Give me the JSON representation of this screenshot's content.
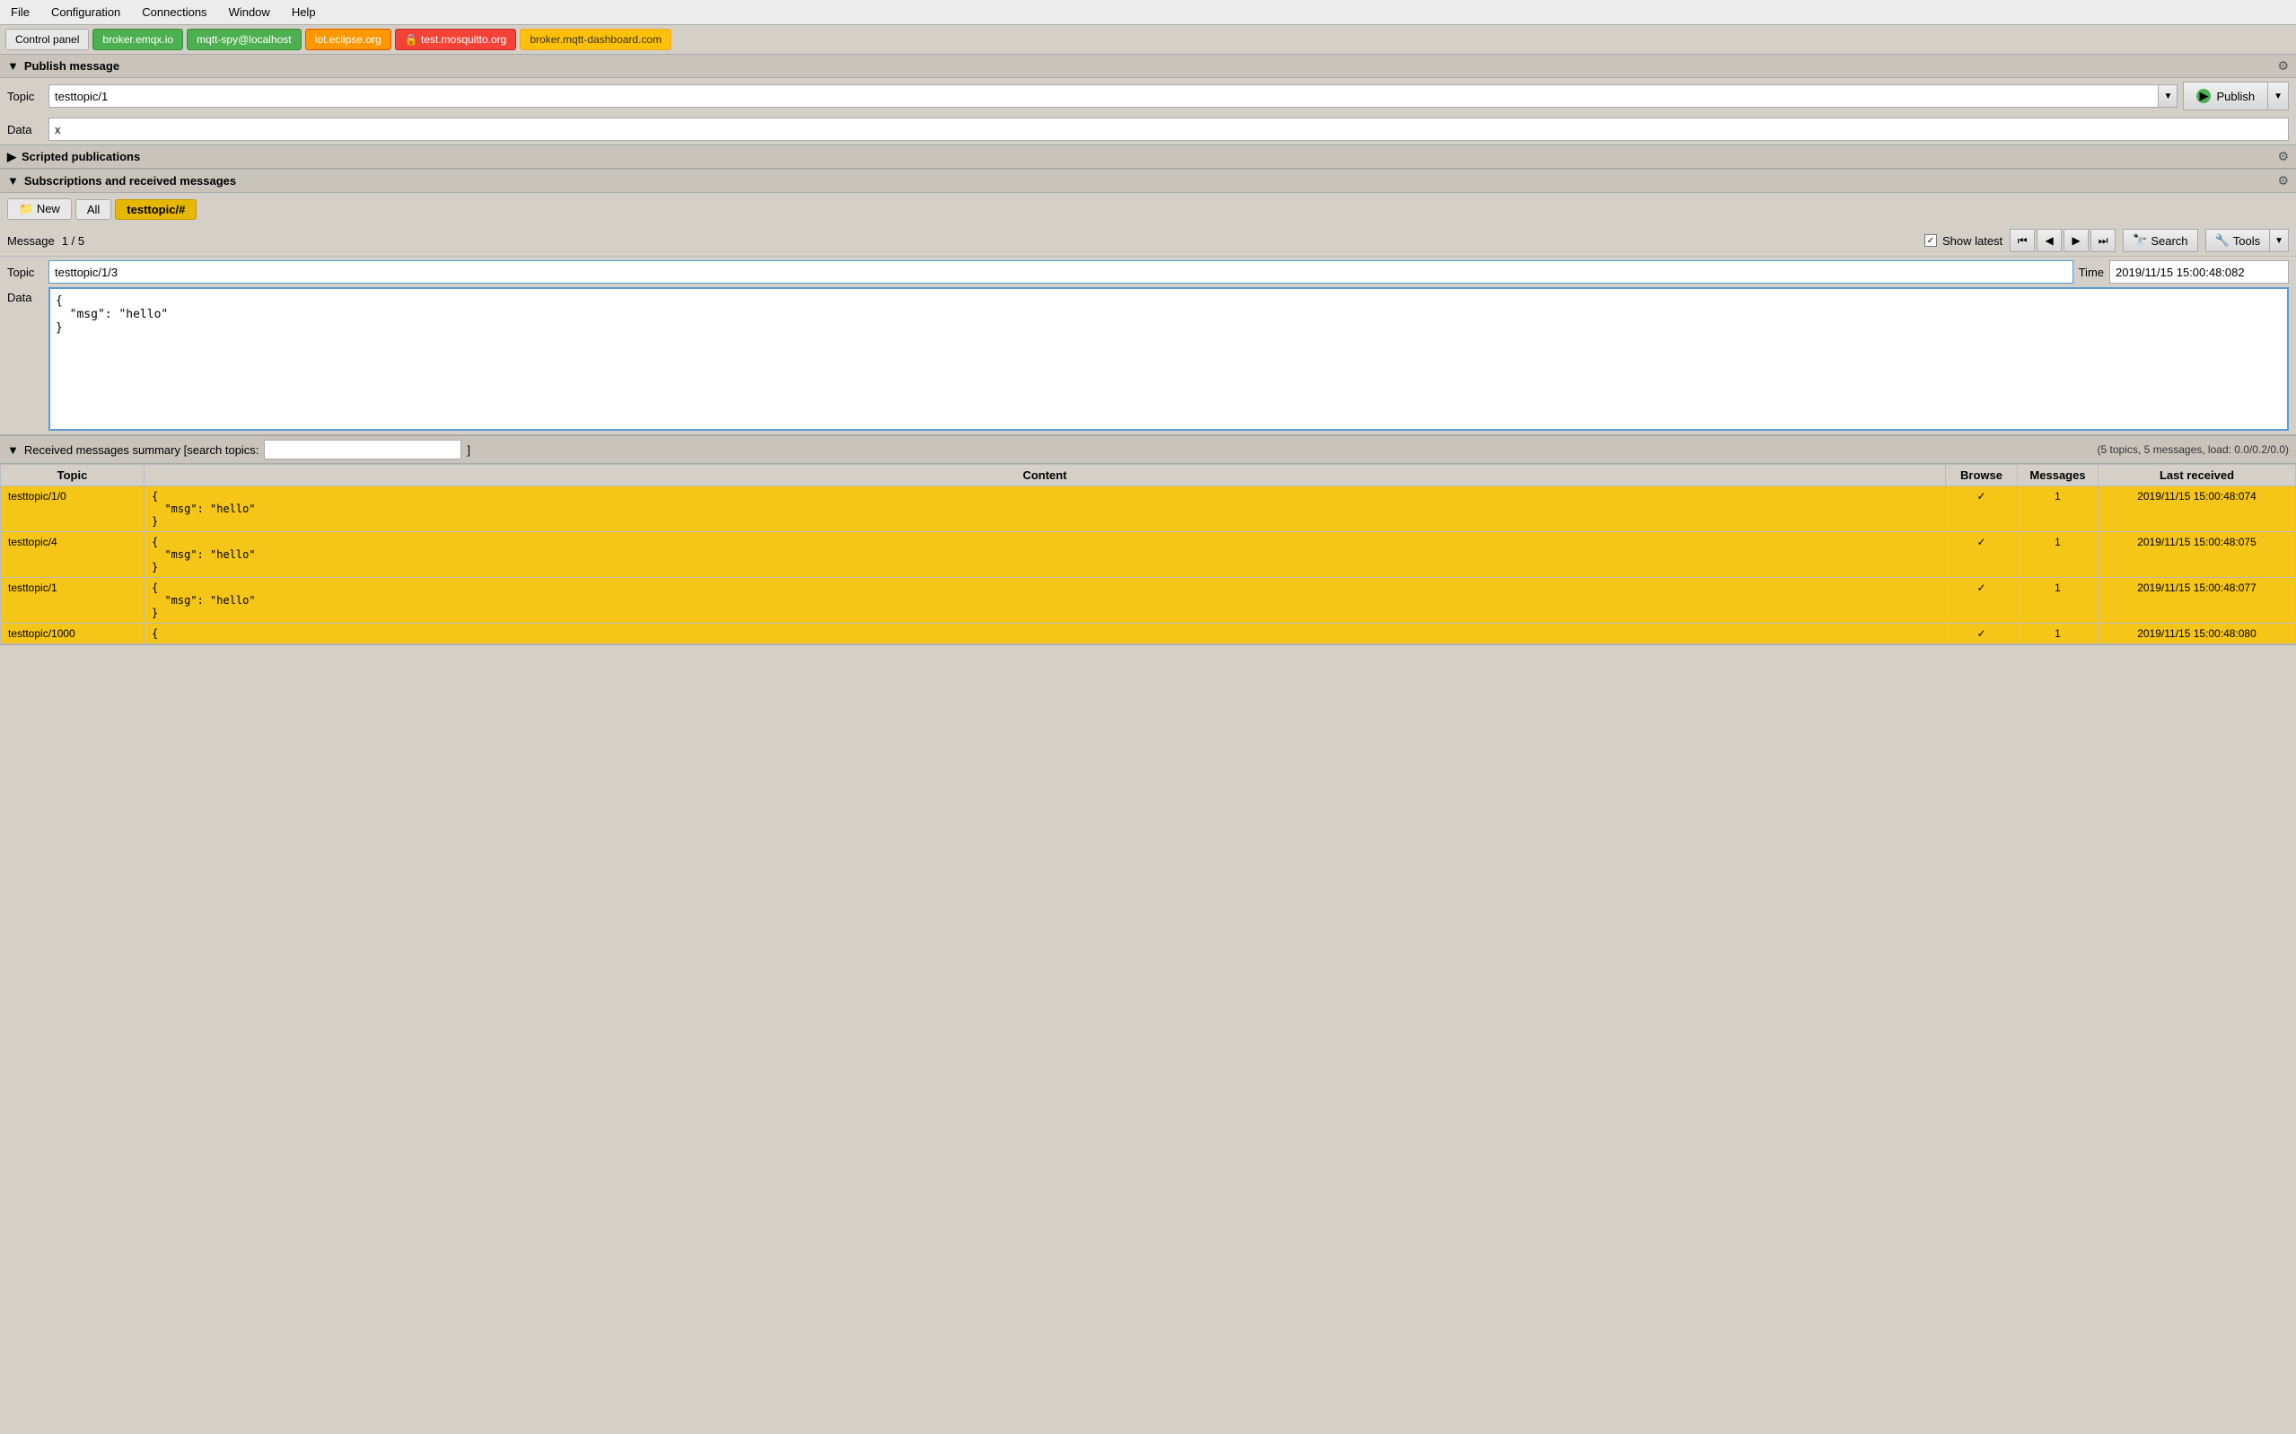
{
  "menubar": {
    "items": [
      "File",
      "Configuration",
      "Connections",
      "Window",
      "Help"
    ]
  },
  "tabs": [
    {
      "label": "Control panel",
      "style": "control"
    },
    {
      "label": "broker.emqx.io",
      "style": "green"
    },
    {
      "label": "mqtt-spy@localhost",
      "style": "green"
    },
    {
      "label": "iot.eclipse.org",
      "style": "orange"
    },
    {
      "label": "🔒 test.mosquitto.org",
      "style": "red"
    },
    {
      "label": "broker.mqtt-dashboard.com",
      "style": "gold"
    }
  ],
  "publish_section": {
    "title": "Publish message",
    "topic_label": "Topic",
    "topic_value": "testtopic/1",
    "data_label": "Data",
    "data_value": "x",
    "publish_btn": "Publish"
  },
  "scripted_section": {
    "title": "Scripted publications"
  },
  "subscriptions_section": {
    "title": "Subscriptions and received messages",
    "new_tab_label": "New",
    "all_tab_label": "All",
    "active_tab_label": "testtopic/#"
  },
  "message_controls": {
    "label": "Message",
    "current": "1",
    "total": "5",
    "show_latest_label": "Show latest",
    "show_latest_checked": true,
    "search_label": "Search",
    "tools_label": "Tools"
  },
  "message_detail": {
    "topic_label": "Topic",
    "topic_value": "testtopic/1/3",
    "time_label": "Time",
    "time_value": "2019/11/15 15:00:48:082",
    "data_label": "Data",
    "data_value": "{\n  \"msg\": \"hello\"\n}"
  },
  "summary": {
    "title": "Received messages summary [search topics:",
    "close_bracket": "]",
    "search_placeholder": "",
    "stats": "(5 topics, 5 messages, load: 0.0/0.2/0.0)"
  },
  "table": {
    "columns": [
      "Topic",
      "Content",
      "Browse",
      "Messages",
      "Last received"
    ],
    "rows": [
      {
        "topic": "testtopic/1/0",
        "content": "{\n  \"msg\": \"hello\"\n}",
        "browse": "✓",
        "messages": "1",
        "last_received": "2019/11/15 15:00:48:074"
      },
      {
        "topic": "testtopic/4",
        "content": "{\n  \"msg\": \"hello\"\n}",
        "browse": "✓",
        "messages": "1",
        "last_received": "2019/11/15 15:00:48:075"
      },
      {
        "topic": "testtopic/1",
        "content": "{\n  \"msg\": \"hello\"\n}",
        "browse": "✓",
        "messages": "1",
        "last_received": "2019/11/15 15:00:48:077"
      },
      {
        "topic": "testtopic/1000",
        "content": "{",
        "browse": "✓",
        "messages": "1",
        "last_received": "2019/11/15 15:00:48:080"
      }
    ]
  }
}
